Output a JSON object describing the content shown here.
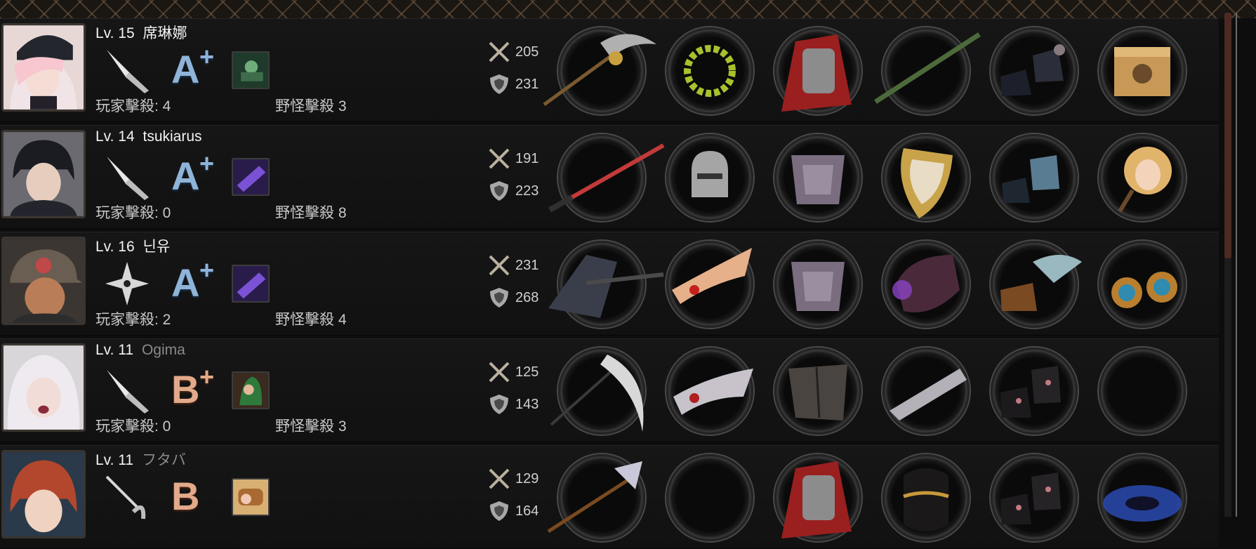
{
  "labels": {
    "player_kills": "玩家擊殺",
    "monster_kills": "野怪擊殺"
  },
  "colors": {
    "grade_a": "#8fb4d8",
    "grade_b": "#e2a98a",
    "background": "#0d0d0d",
    "scroll_thumb": "#4c2a22"
  },
  "players": [
    {
      "level": "Lv. 15",
      "name": "席琳娜",
      "name_dim": false,
      "weapon_type": "knife-icon",
      "grade": "A",
      "grade_plus": "+",
      "skill_icon": "sniper-skill-icon",
      "player_kills": "玩家擊殺: 4",
      "monster_kills": "野怪擊殺 3",
      "attack": "205",
      "defense": "231",
      "equipment": [
        "scythe-weapon-icon",
        "laurel-wreath-icon",
        "red-cape-armor-icon",
        "stick-arm-icon",
        "dark-boots-icon",
        "cat-box-icon"
      ]
    },
    {
      "level": "Lv. 14",
      "name": "tsukiarus",
      "name_dim": false,
      "weapon_type": "knife-icon",
      "grade": "A",
      "grade_plus": "+",
      "skill_icon": "purple-gun-skill-icon",
      "player_kills": "玩家擊殺: 0",
      "monster_kills": "野怪擊殺 8",
      "attack": "191",
      "defense": "223",
      "equipment": [
        "red-katana-icon",
        "knight-helmet-icon",
        "steel-armor-icon",
        "gold-shield-icon",
        "blue-boots-icon",
        "portrait-fan-icon"
      ]
    },
    {
      "level": "Lv. 16",
      "name": "닌유",
      "name_dim": false,
      "weapon_type": "shuriken-icon",
      "grade": "A",
      "grade_plus": "+",
      "skill_icon": "purple-gun-skill-icon",
      "player_kills": "玩家擊殺: 2",
      "monster_kills": "野怪擊殺 4",
      "attack": "231",
      "defense": "268",
      "equipment": [
        "dark-axe-icon",
        "winged-tiara-icon",
        "steel-armor-icon",
        "purple-gauntlet-icon",
        "winged-boots-icon",
        "gold-earrings-icon"
      ]
    },
    {
      "level": "Lv. 11",
      "name": "Ogima",
      "name_dim": true,
      "weapon_type": "knife-icon",
      "grade": "B",
      "grade_plus": "+",
      "skill_icon": "green-hair-skill-icon",
      "player_kills": "玩家擊殺: 0",
      "monster_kills": "野怪擊殺 3",
      "attack": "125",
      "defense": "143",
      "equipment": [
        "bone-scythe-icon",
        "silver-tiara-icon",
        "leather-jacket-icon",
        "silver-bracer-icon",
        "black-boots-icon",
        "empty-slot"
      ]
    },
    {
      "level": "Lv. 11",
      "name": "フタバ",
      "name_dim": true,
      "weapon_type": "rapier-icon",
      "grade": "B",
      "grade_plus": "",
      "skill_icon": "bread-skill-icon",
      "player_kills": "",
      "monster_kills": "",
      "attack": "129",
      "defense": "164",
      "equipment": [
        "spear-axe-icon",
        "empty-slot",
        "red-cape-armor-icon",
        "gold-bracer-icon",
        "black-boots-icon",
        "galaxy-icon"
      ]
    }
  ]
}
